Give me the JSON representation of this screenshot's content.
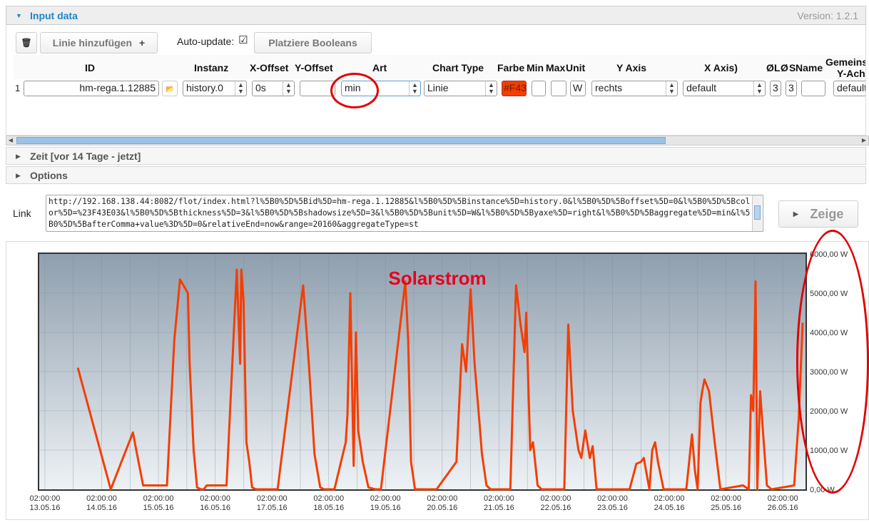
{
  "panel": {
    "title": "Input data",
    "version": "Version: 1.2.1",
    "add_line_label": "Linie hinzufügen",
    "add_line_plus": "+",
    "auto_update_label": "Auto-update:",
    "auto_update_checked": "☑",
    "booleans_label": "Platziere Booleans"
  },
  "columns": {
    "id": "ID",
    "instanz": "Instanz",
    "xoffset": "X-Offset",
    "yoffset": "Y-Offset",
    "art": "Art",
    "chart_type": "Chart Type",
    "farbe": "Farbe",
    "min": "Min",
    "max": "Max",
    "unit": "Unit",
    "y_axis": "Y Axis",
    "x_axis": "X Axis)",
    "oe": "Ø",
    "l": "L",
    "oe2": "Ø",
    "s": "S",
    "name": "Name",
    "gemeins1": "Gemeins",
    "gemeins2": "Y-Achs"
  },
  "row": {
    "index": "1",
    "id": "hm-rega.1.12885",
    "instanz": "history.0",
    "xoffset": "0s",
    "yoffset": "",
    "art": "min",
    "chart_type": "Linie",
    "farbe": "#F43",
    "min": "",
    "max": "",
    "unit": "W",
    "y_axis": "rechts",
    "x_axis": "default",
    "thickness": "3",
    "shadow": "3",
    "name": "",
    "common": "default"
  },
  "sections": {
    "zeit": "Zeit [vor 14 Tage - jetzt]",
    "options": "Options"
  },
  "link": {
    "label": "Link",
    "url": "http://192.168.138.44:8082/flot/index.html?l%5B0%5D%5Bid%5D=hm-rega.1.12885&l%5B0%5D%5Binstance%5D=history.0&l%5B0%5D%5Boffset%5D=0&l%5B0%5D%5Bcolor%5D=%23F43E03&l%5B0%5D%5Bthickness%5D=3&l%5B0%5D%5Bshadowsize%5D=3&l%5B0%5D%5Bunit%5D=W&l%5B0%5D%5Byaxe%5D=right&l%5B0%5D%5Baggregate%5D=min&l%5B0%5D%5BafterComma+value%3D%5D=0&relativeEnd=now&range=20160&aggregateType=st",
    "show_label": "Zeige"
  },
  "colors": {
    "accent": "#1e86c8",
    "series": "#f43e03",
    "title": "#e8001c",
    "annotation": "#e10000"
  },
  "chart_data": {
    "type": "line",
    "title": "Solarstrom",
    "x_tick_times": [
      "02:00:00",
      "02:00:00",
      "02:00:00",
      "02:00:00",
      "02:00:00",
      "02:00:00",
      "02:00:00",
      "02:00:00",
      "02:00:00",
      "02:00:00",
      "02:00:00",
      "02:00:00",
      "02:00:00",
      "02:00:00"
    ],
    "x_tick_dates": [
      "13.05.16",
      "14.05.16",
      "15.05.16",
      "16.05.16",
      "17.05.16",
      "18.05.16",
      "19.05.16",
      "20.05.16",
      "21.05.16",
      "22.05.16",
      "23.05.16",
      "24.05.16",
      "25.05.16",
      "26.05.16"
    ],
    "x_range_days": [
      12.9,
      26.4
    ],
    "y_ticks": [
      "0,00 W",
      "1000,00 W",
      "2000,00 W",
      "3000,00 W",
      "4000,00 W",
      "5000,00 W",
      "6000,00 W"
    ],
    "ylim": [
      0,
      6000
    ],
    "y_axis_position": "right",
    "grid": true,
    "series": [
      {
        "unit": "W",
        "x": [
          13.58,
          14.16,
          14.55,
          14.61,
          14.73,
          15.15,
          15.28,
          15.38,
          15.44,
          15.52,
          15.55,
          15.62,
          15.68,
          15.75,
          15.8,
          15.85,
          16.2,
          16.38,
          16.42,
          16.44,
          16.46,
          16.5,
          16.55,
          16.6,
          16.65,
          16.72,
          17.1,
          17.55,
          17.65,
          17.75,
          17.85,
          17.92,
          18.1,
          18.3,
          18.33,
          18.38,
          18.44,
          18.48,
          18.52,
          18.6,
          18.7,
          18.82,
          18.92,
          19.35,
          19.4,
          19.45,
          19.52,
          19.6,
          19.7,
          19.9,
          20.25,
          20.35,
          20.42,
          20.5,
          20.57,
          20.65,
          20.7,
          20.78,
          20.85,
          21.2,
          21.3,
          21.38,
          21.45,
          21.48,
          21.55,
          21.6,
          21.68,
          21.75,
          21.8,
          21.85,
          22.15,
          22.22,
          22.3,
          22.4,
          22.45,
          22.52,
          22.6,
          22.65,
          22.72,
          22.9,
          23.3,
          23.42,
          23.5,
          23.55,
          23.65,
          23.7,
          23.75,
          23.8,
          23.9,
          24.3,
          24.4,
          24.45,
          24.5,
          24.55,
          24.58,
          24.62,
          24.7,
          24.8,
          24.9,
          25.3,
          25.4,
          25.44,
          25.48,
          25.52,
          25.55,
          25.6,
          25.65,
          25.72,
          25.8,
          26.2,
          26.28,
          26.35
        ],
        "y": [
          3100,
          0,
          1450,
          1000,
          100,
          100,
          3800,
          5350,
          5200,
          5000,
          3200,
          1000,
          50,
          0,
          0,
          100,
          100,
          5600,
          4000,
          3200,
          5600,
          4800,
          1200,
          700,
          50,
          0,
          0,
          5200,
          3200,
          900,
          50,
          0,
          0,
          1200,
          1900,
          5000,
          600,
          4000,
          1500,
          700,
          50,
          0,
          0,
          5300,
          3800,
          700,
          0,
          0,
          0,
          0,
          700,
          3700,
          3000,
          5100,
          3200,
          1800,
          900,
          100,
          0,
          0,
          5200,
          4200,
          3500,
          4500,
          1000,
          1200,
          100,
          0,
          0,
          0,
          0,
          4200,
          2000,
          1000,
          800,
          1500,
          800,
          1100,
          0,
          0,
          0,
          650,
          700,
          800,
          0,
          1000,
          1200,
          700,
          0,
          0,
          1400,
          500,
          0,
          2200,
          2500,
          2800,
          2500,
          1200,
          0,
          100,
          0,
          2400,
          2000,
          5300,
          0,
          2500,
          1500,
          100,
          0,
          100,
          1800,
          4250
        ]
      }
    ]
  }
}
